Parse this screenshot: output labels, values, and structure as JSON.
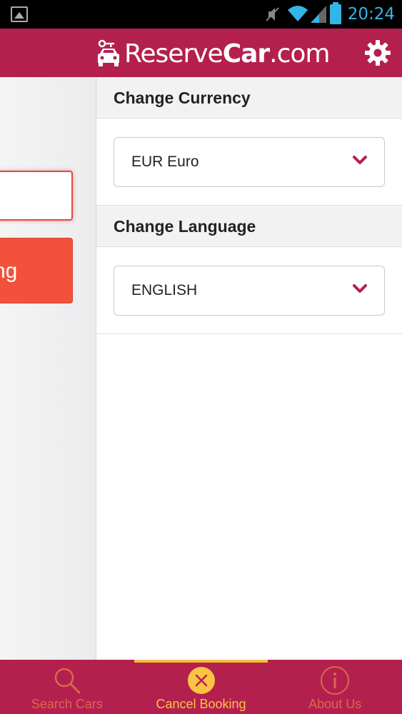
{
  "status_bar": {
    "time": "20:24",
    "icons": [
      "gallery-icon",
      "mute-icon",
      "wifi-icon",
      "signal-icon",
      "battery-icon"
    ]
  },
  "header": {
    "brand_regular": "Reserve",
    "brand_bold": "Car",
    "brand_suffix": ".com",
    "settings_icon": "gear-icon"
  },
  "left_panel": {
    "input_value": "",
    "button_label_partial": "ng"
  },
  "drawer": {
    "currency": {
      "title": "Change Currency",
      "selected": "EUR Euro"
    },
    "language": {
      "title": "Change Language",
      "selected": "ENGLISH"
    }
  },
  "bottom_nav": {
    "items": [
      {
        "label": "Search Cars",
        "icon": "search-icon",
        "active": false
      },
      {
        "label": "Cancel Booking",
        "icon": "close-circle-icon",
        "active": true
      },
      {
        "label": "About Us",
        "icon": "info-icon",
        "active": false
      }
    ]
  },
  "colors": {
    "brand": "#b4204e",
    "accent_active": "#f9c443",
    "inactive_nav": "#d86a4a",
    "primary_button": "#f2513b",
    "status_blue": "#33b5e5"
  }
}
